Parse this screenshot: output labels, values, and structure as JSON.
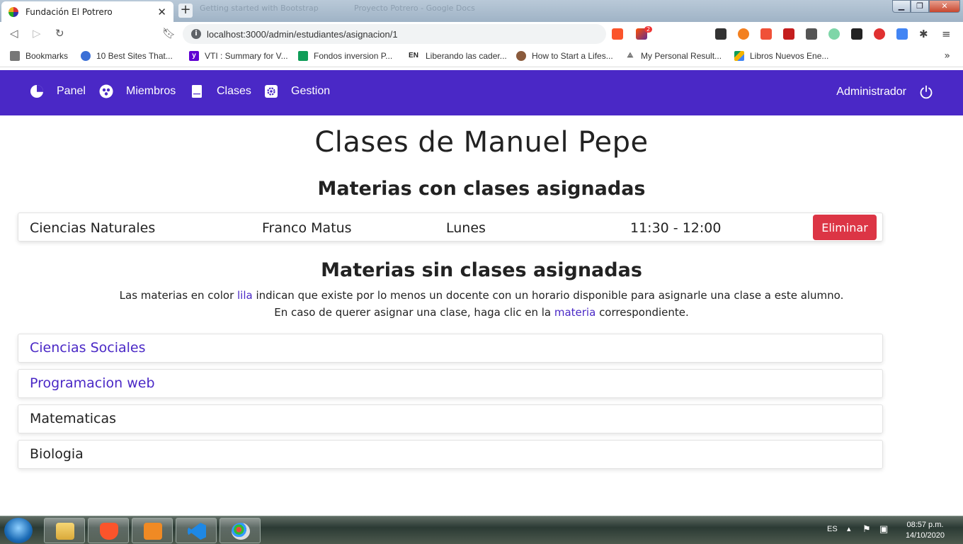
{
  "browser": {
    "active_tab_title": "Fundación El Potrero",
    "background_tabs": [
      "Getting started with Bootstrap",
      "Proyecto Potrero - Google Docs"
    ],
    "url": "localhost:3000/admin/estudiantes/asignacion/1",
    "notification_count": "2",
    "bookmarks": [
      {
        "label": "Bookmarks",
        "icon": "bookmark-folder-icon",
        "color": "#555555"
      },
      {
        "label": "10 Best Sites That...",
        "icon": "spiral-icon",
        "color": "#3b6fd6"
      },
      {
        "label": "VTI : Summary for V...",
        "icon": "yahoo-icon",
        "color": "#6001d2"
      },
      {
        "label": "Fondos inversion P...",
        "icon": "sheets-icon",
        "color": "#0f9d58"
      },
      {
        "label": "Liberando las cader...",
        "icon": "en-icon",
        "color": "#222222"
      },
      {
        "label": "How to Start a Lifes...",
        "icon": "person-icon",
        "color": "#8a5a3c"
      },
      {
        "label": "My Personal Result...",
        "icon": "compass-icon",
        "color": "#666666"
      },
      {
        "label": "Libros Nuevos Ene...",
        "icon": "drive-icon",
        "color": "#f4b400"
      }
    ]
  },
  "navbar": {
    "items": [
      {
        "label": "Panel",
        "icon": "pie-chart-icon"
      },
      {
        "label": "Miembros",
        "icon": "users-icon"
      },
      {
        "label": "Clases",
        "icon": "book-icon"
      },
      {
        "label": "Gestion",
        "icon": "settings-icon"
      }
    ],
    "user_label": "Administrador",
    "bg_color": "#4a28c6"
  },
  "page": {
    "title": "Clases de Manuel Pepe",
    "assigned_heading": "Materias con clases asignadas",
    "assigned": [
      {
        "subject": "Ciencias Naturales",
        "teacher": "Franco Matus",
        "day": "Lunes",
        "time": "11:30 - 12:00",
        "action": "Eliminar"
      }
    ],
    "unassigned_heading": "Materias sin clases asignadas",
    "description": {
      "line1_a": "Las materias en color ",
      "line1_lila": "lila",
      "line1_b": " indican que existe por lo menos un docente con un horario disponible para asignarle una clase a este alumno.",
      "line2_a": "En caso de querer asignar una clase, haga clic en la ",
      "line2_lila": "materia",
      "line2_b": " correspondiente."
    },
    "unassigned": [
      {
        "name": "Ciencias Sociales",
        "available": true
      },
      {
        "name": "Programacion web",
        "available": true
      },
      {
        "name": "Matematicas",
        "available": false
      },
      {
        "name": "Biologia",
        "available": false
      }
    ],
    "accent_color": "#4a28c6",
    "danger_color": "#dc3545"
  },
  "taskbar": {
    "language": "ES",
    "time": "08:57 p.m.",
    "date": "14/10/2020"
  }
}
